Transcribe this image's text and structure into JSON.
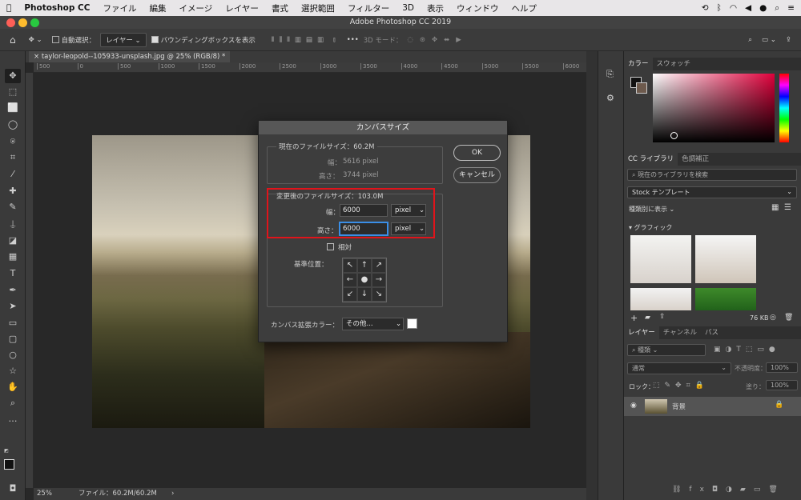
{
  "menubar": {
    "app": "Photoshop CC",
    "items": [
      "ファイル",
      "編集",
      "イメージ",
      "レイヤー",
      "書式",
      "選択範囲",
      "フィルター",
      "3D",
      "表示",
      "ウィンドウ",
      "ヘルプ"
    ]
  },
  "window": {
    "title": "Adobe Photoshop CC 2019"
  },
  "options": {
    "auto_select_label": "自動選択：",
    "auto_select_value": "レイヤー",
    "transform_label": "バウンディングボックスを表示",
    "mode3d_label": "3D モード："
  },
  "document": {
    "tab_title": "taylor-leopold--105933-unsplash.jpg @ 25% (RGB/8) *",
    "ruler_ticks": [
      "500",
      "0",
      "500",
      "1000",
      "1500",
      "2000",
      "2500",
      "3000",
      "3500",
      "4000",
      "4500",
      "5000",
      "5500",
      "6000"
    ]
  },
  "status": {
    "zoom": "25%",
    "file_info": "ファイル：60.2M/60.2M"
  },
  "dialog": {
    "title": "カンバスサイズ",
    "current_size_label": "現在のファイルサイズ：60.2M",
    "cur_width_label": "幅：",
    "cur_width_value": "5616 pixel",
    "cur_height_label": "高さ：",
    "cur_height_value": "3744 pixel",
    "new_size_label": "変更後のファイルサイズ：103.0M",
    "new_width_label": "幅：",
    "new_width_value": "6000",
    "new_width_unit": "pixel",
    "new_height_label": "高さ：",
    "new_height_value": "6000",
    "new_height_unit": "pixel",
    "relative_label": "相対",
    "anchor_label": "基準位置：",
    "ext_color_label": "カンバス拡張カラー：",
    "ext_color_value": "その他...",
    "ok_label": "OK",
    "cancel_label": "キャンセル",
    "anchor_arrows": [
      "↖",
      "↑",
      "↗",
      "←",
      "●",
      "→",
      "↙",
      "↓",
      "↘"
    ]
  },
  "panels": {
    "color_tabs": [
      "カラー",
      "スウォッチ"
    ],
    "library_tabs": [
      "CC ライブラリ",
      "色調補正"
    ],
    "library_search_placeholder": "現在のライブラリを検索",
    "library_select": "Stock テンプレート",
    "view_by_type": "種類別に表示",
    "graphics_label": "グラフィック",
    "library_size": "76 KB",
    "layer_tabs": [
      "レイヤー",
      "チャンネル",
      "パス"
    ],
    "layer_kind": "種類",
    "blend_mode": "通常",
    "opacity_label": "不透明度：",
    "opacity_value": "100%",
    "lock_label": "ロック：",
    "fill_label": "塗り：",
    "fill_value": "100%",
    "layer_name": "背景"
  },
  "colors": {
    "accent_red": "#e0141b",
    "focus_blue": "#3a8ee6"
  }
}
